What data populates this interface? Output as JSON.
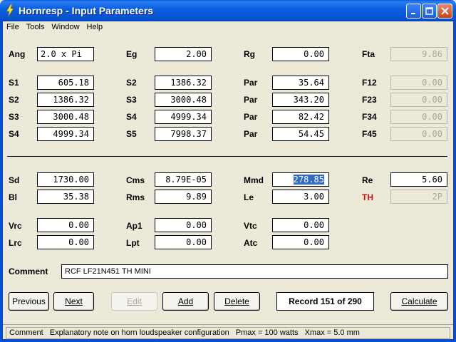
{
  "window": {
    "title": "Hornresp - Input Parameters",
    "icon": "hornresp-lightning-icon"
  },
  "menu": [
    "File",
    "Tools",
    "Window",
    "Help"
  ],
  "params": {
    "Ang": {
      "label": "Ang",
      "value": "2.0 x Pi"
    },
    "Eg": {
      "label": "Eg",
      "value": "2.00"
    },
    "Rg": {
      "label": "Rg",
      "value": "0.00"
    },
    "Fta": {
      "label": "Fta",
      "value": "9.86"
    },
    "S1a": {
      "label": "S1",
      "value": "605.18"
    },
    "S2a": {
      "label": "S2",
      "value": "1386.32"
    },
    "Par1": {
      "label": "Par",
      "value": "35.64"
    },
    "F12": {
      "label": "F12",
      "value": "0.00"
    },
    "S2b": {
      "label": "S2",
      "value": "1386.32"
    },
    "S3a": {
      "label": "S3",
      "value": "3000.48"
    },
    "Par2": {
      "label": "Par",
      "value": "343.20"
    },
    "F23": {
      "label": "F23",
      "value": "0.00"
    },
    "S3b": {
      "label": "S3",
      "value": "3000.48"
    },
    "S4a": {
      "label": "S4",
      "value": "4999.34"
    },
    "Par3": {
      "label": "Par",
      "value": "82.42"
    },
    "F34": {
      "label": "F34",
      "value": "0.00"
    },
    "S4b": {
      "label": "S4",
      "value": "4999.34"
    },
    "S5": {
      "label": "S5",
      "value": "7998.37"
    },
    "Par4": {
      "label": "Par",
      "value": "54.45"
    },
    "F45": {
      "label": "F45",
      "value": "0.00"
    },
    "Sd": {
      "label": "Sd",
      "value": "1730.00"
    },
    "Cms": {
      "label": "Cms",
      "value": "8.79E-05"
    },
    "Mmd": {
      "label": "Mmd",
      "value": "278.85"
    },
    "Re": {
      "label": "Re",
      "value": "5.60"
    },
    "Bl": {
      "label": "Bl",
      "value": "35.38"
    },
    "Rms": {
      "label": "Rms",
      "value": "9.89"
    },
    "Le": {
      "label": "Le",
      "value": "3.00"
    },
    "TH": {
      "label": "TH",
      "value": "2P"
    },
    "Vrc": {
      "label": "Vrc",
      "value": "0.00"
    },
    "Ap1": {
      "label": "Ap1",
      "value": "0.00"
    },
    "Vtc": {
      "label": "Vtc",
      "value": "0.00"
    },
    "Lrc": {
      "label": "Lrc",
      "value": "0.00"
    },
    "Lpt": {
      "label": "Lpt",
      "value": "0.00"
    },
    "Atc": {
      "label": "Atc",
      "value": "0.00"
    }
  },
  "comment": {
    "label": "Comment",
    "value": "RCF LF21N451 TH MINI"
  },
  "buttons": {
    "previous": "Previous",
    "next": "Next",
    "edit": "Edit",
    "add": "Add",
    "delete": "Delete",
    "calculate": "Calculate"
  },
  "record": "Record 151 of 290",
  "status": {
    "field": "Comment",
    "description": "Explanatory note on horn loudspeaker configuration",
    "pmax": "Pmax = 100 watts",
    "xmax": "Xmax = 5.0 mm"
  },
  "colors": {
    "titlebar": "#0552d0",
    "background": "#ece9d8",
    "selection": "#316ac5",
    "th_label": "#d01010"
  }
}
